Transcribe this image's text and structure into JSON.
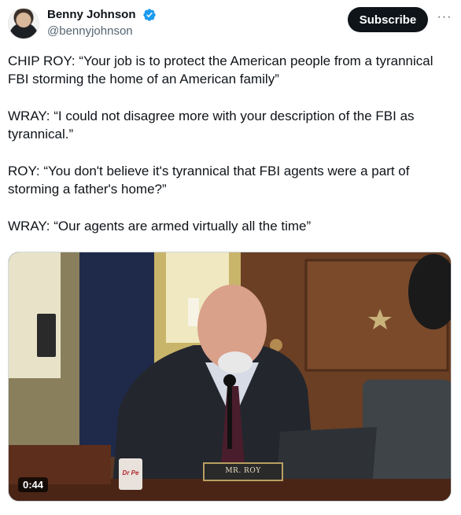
{
  "author": {
    "display_name": "Benny Johnson",
    "handle": "@bennyjohnson",
    "verified_icon": "verified-badge-icon",
    "verified_color": "#1d9bf0"
  },
  "actions": {
    "subscribe_label": "Subscribe",
    "more_label": "···"
  },
  "tweet": {
    "paragraphs": [
      "CHIP ROY: “Your job is to protect the American people from a tyrannical FBI storming the home of an American family”",
      "WRAY: “I could not disagree more with your description of the FBI as tyrannical.”",
      "ROY: “You don't believe it's tyrannical that FBI agents were a part of storming a father's home?”",
      "WRAY: “Our agents are armed virtually all the time”"
    ]
  },
  "media": {
    "duration": "0:44",
    "nameplate": "MR. ROY",
    "can_label": "Dr Pe"
  }
}
